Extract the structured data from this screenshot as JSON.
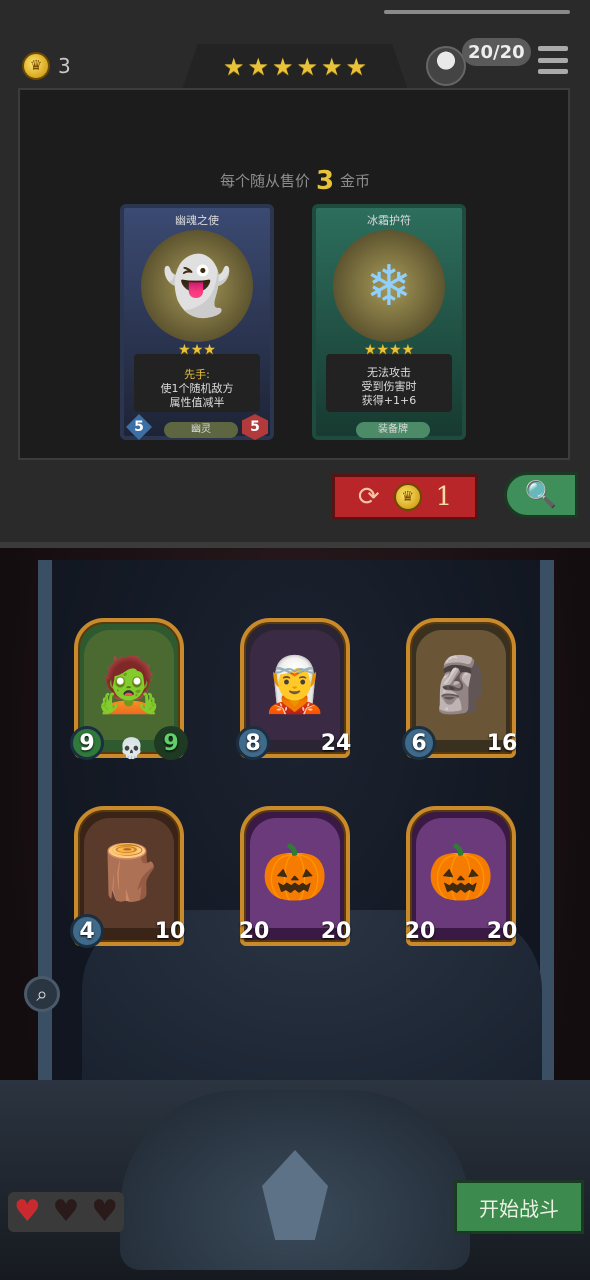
{
  "header": {
    "gold": "3",
    "tier_stars": [
      "★",
      "★",
      "★",
      "★",
      "★",
      "★"
    ],
    "lives_counter": "20/20",
    "menu_icon": "hamburger-icon"
  },
  "shop": {
    "price_prefix": "每个随从售价",
    "price_value": "3",
    "price_suffix": "金币",
    "cards": [
      {
        "name": "幽魂之使",
        "type": "minion",
        "stars": [
          "★",
          "★",
          "★"
        ],
        "keyword": "先手:",
        "text_line1": "使1个随机敌方",
        "text_line2": "属性值减半",
        "tag": "幽灵",
        "attack": "5",
        "health": "5"
      },
      {
        "name": "冰霜护符",
        "type": "equipment",
        "stars": [
          "★",
          "★",
          "★",
          "★"
        ],
        "text_line1": "无法攻击",
        "text_line2": "受到伤害时",
        "text_line3": "获得+1+6",
        "tag": "装备牌"
      }
    ],
    "refresh_cost": "1"
  },
  "board": {
    "units": [
      {
        "attack": "9",
        "health": "9",
        "color": "#2f7a3a",
        "hp_color": "#2f7a3a",
        "skull": "💀"
      },
      {
        "attack": "8",
        "health": "24",
        "color": "#3a2a44"
      },
      {
        "attack": "6",
        "health": "16",
        "color": "#5a4a30"
      },
      {
        "attack": "4",
        "health": "10",
        "color": "#5a3a2a"
      },
      {
        "attack": "20",
        "health": "20",
        "color": "#5a2a6a"
      },
      {
        "attack": "20",
        "health": "20",
        "color": "#5a2a6a"
      }
    ]
  },
  "footer": {
    "hearts": [
      "♥",
      "♥",
      "♥"
    ],
    "start_label": "开始战斗"
  },
  "colors": {
    "gold": "#e8c33a",
    "refresh_red": "#b8262a",
    "start_green": "#3d8a4e"
  }
}
